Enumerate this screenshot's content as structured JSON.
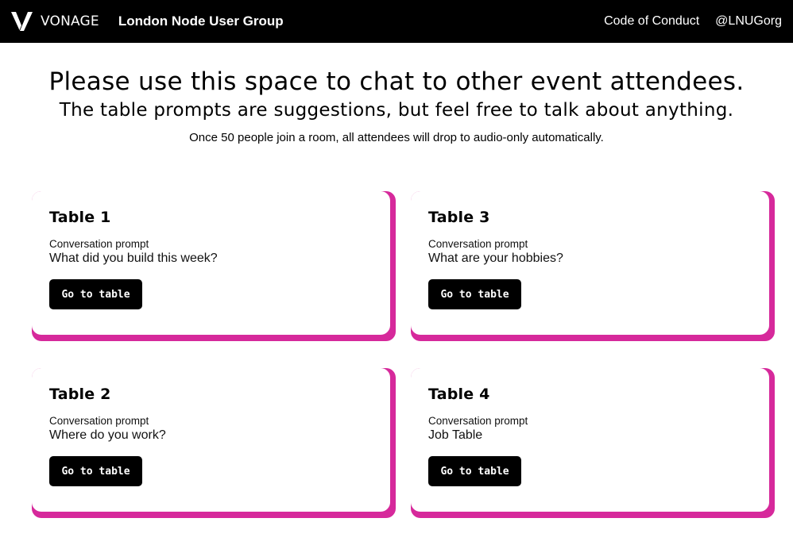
{
  "navbar": {
    "brand": "VONAGE",
    "group_name": "London Node User Group",
    "links": [
      "Code of Conduct",
      "@LNUGorg"
    ],
    "logo_icon": "vonage-v-logo",
    "background": "#000000",
    "text_color": "#ffffff"
  },
  "intro": {
    "headline": "Please use this space to chat to other event attendees.",
    "subheadline": "The table prompts are suggestions, but feel free to talk about anything.",
    "note": "Once 50 people join a room, all attendees will drop to audio-only automatically."
  },
  "accent_color": "#d6299b",
  "tables": [
    {
      "title": "Table 1",
      "prompt_label": "Conversation prompt",
      "prompt": "What did you build this week?",
      "button_label": "Go to table"
    },
    {
      "title": "Table 3",
      "prompt_label": "Conversation prompt",
      "prompt": "What are your hobbies?",
      "button_label": "Go to table"
    },
    {
      "title": "Table 2",
      "prompt_label": "Conversation prompt",
      "prompt": "Where do you work?",
      "button_label": "Go to table"
    },
    {
      "title": "Table 4",
      "prompt_label": "Conversation prompt",
      "prompt": "Job Table",
      "button_label": "Go to table"
    }
  ]
}
